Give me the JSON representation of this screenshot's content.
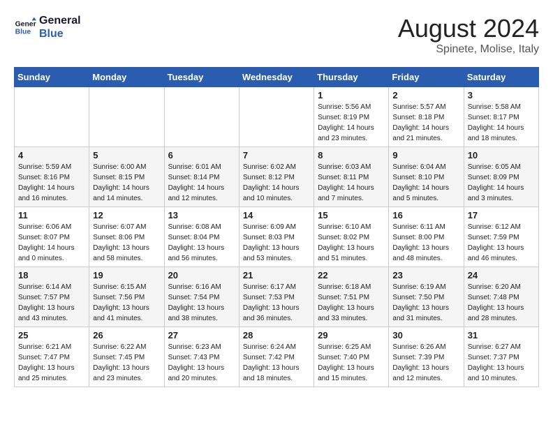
{
  "logo": {
    "line1": "General",
    "line2": "Blue"
  },
  "title": "August 2024",
  "location": "Spinete, Molise, Italy",
  "days_header": [
    "Sunday",
    "Monday",
    "Tuesday",
    "Wednesday",
    "Thursday",
    "Friday",
    "Saturday"
  ],
  "weeks": [
    [
      {
        "day": "",
        "info": ""
      },
      {
        "day": "",
        "info": ""
      },
      {
        "day": "",
        "info": ""
      },
      {
        "day": "",
        "info": ""
      },
      {
        "day": "1",
        "info": "Sunrise: 5:56 AM\nSunset: 8:19 PM\nDaylight: 14 hours\nand 23 minutes."
      },
      {
        "day": "2",
        "info": "Sunrise: 5:57 AM\nSunset: 8:18 PM\nDaylight: 14 hours\nand 21 minutes."
      },
      {
        "day": "3",
        "info": "Sunrise: 5:58 AM\nSunset: 8:17 PM\nDaylight: 14 hours\nand 18 minutes."
      }
    ],
    [
      {
        "day": "4",
        "info": "Sunrise: 5:59 AM\nSunset: 8:16 PM\nDaylight: 14 hours\nand 16 minutes."
      },
      {
        "day": "5",
        "info": "Sunrise: 6:00 AM\nSunset: 8:15 PM\nDaylight: 14 hours\nand 14 minutes."
      },
      {
        "day": "6",
        "info": "Sunrise: 6:01 AM\nSunset: 8:14 PM\nDaylight: 14 hours\nand 12 minutes."
      },
      {
        "day": "7",
        "info": "Sunrise: 6:02 AM\nSunset: 8:12 PM\nDaylight: 14 hours\nand 10 minutes."
      },
      {
        "day": "8",
        "info": "Sunrise: 6:03 AM\nSunset: 8:11 PM\nDaylight: 14 hours\nand 7 minutes."
      },
      {
        "day": "9",
        "info": "Sunrise: 6:04 AM\nSunset: 8:10 PM\nDaylight: 14 hours\nand 5 minutes."
      },
      {
        "day": "10",
        "info": "Sunrise: 6:05 AM\nSunset: 8:09 PM\nDaylight: 14 hours\nand 3 minutes."
      }
    ],
    [
      {
        "day": "11",
        "info": "Sunrise: 6:06 AM\nSunset: 8:07 PM\nDaylight: 14 hours\nand 0 minutes."
      },
      {
        "day": "12",
        "info": "Sunrise: 6:07 AM\nSunset: 8:06 PM\nDaylight: 13 hours\nand 58 minutes."
      },
      {
        "day": "13",
        "info": "Sunrise: 6:08 AM\nSunset: 8:04 PM\nDaylight: 13 hours\nand 56 minutes."
      },
      {
        "day": "14",
        "info": "Sunrise: 6:09 AM\nSunset: 8:03 PM\nDaylight: 13 hours\nand 53 minutes."
      },
      {
        "day": "15",
        "info": "Sunrise: 6:10 AM\nSunset: 8:02 PM\nDaylight: 13 hours\nand 51 minutes."
      },
      {
        "day": "16",
        "info": "Sunrise: 6:11 AM\nSunset: 8:00 PM\nDaylight: 13 hours\nand 48 minutes."
      },
      {
        "day": "17",
        "info": "Sunrise: 6:12 AM\nSunset: 7:59 PM\nDaylight: 13 hours\nand 46 minutes."
      }
    ],
    [
      {
        "day": "18",
        "info": "Sunrise: 6:14 AM\nSunset: 7:57 PM\nDaylight: 13 hours\nand 43 minutes."
      },
      {
        "day": "19",
        "info": "Sunrise: 6:15 AM\nSunset: 7:56 PM\nDaylight: 13 hours\nand 41 minutes."
      },
      {
        "day": "20",
        "info": "Sunrise: 6:16 AM\nSunset: 7:54 PM\nDaylight: 13 hours\nand 38 minutes."
      },
      {
        "day": "21",
        "info": "Sunrise: 6:17 AM\nSunset: 7:53 PM\nDaylight: 13 hours\nand 36 minutes."
      },
      {
        "day": "22",
        "info": "Sunrise: 6:18 AM\nSunset: 7:51 PM\nDaylight: 13 hours\nand 33 minutes."
      },
      {
        "day": "23",
        "info": "Sunrise: 6:19 AM\nSunset: 7:50 PM\nDaylight: 13 hours\nand 31 minutes."
      },
      {
        "day": "24",
        "info": "Sunrise: 6:20 AM\nSunset: 7:48 PM\nDaylight: 13 hours\nand 28 minutes."
      }
    ],
    [
      {
        "day": "25",
        "info": "Sunrise: 6:21 AM\nSunset: 7:47 PM\nDaylight: 13 hours\nand 25 minutes."
      },
      {
        "day": "26",
        "info": "Sunrise: 6:22 AM\nSunset: 7:45 PM\nDaylight: 13 hours\nand 23 minutes."
      },
      {
        "day": "27",
        "info": "Sunrise: 6:23 AM\nSunset: 7:43 PM\nDaylight: 13 hours\nand 20 minutes."
      },
      {
        "day": "28",
        "info": "Sunrise: 6:24 AM\nSunset: 7:42 PM\nDaylight: 13 hours\nand 18 minutes."
      },
      {
        "day": "29",
        "info": "Sunrise: 6:25 AM\nSunset: 7:40 PM\nDaylight: 13 hours\nand 15 minutes."
      },
      {
        "day": "30",
        "info": "Sunrise: 6:26 AM\nSunset: 7:39 PM\nDaylight: 13 hours\nand 12 minutes."
      },
      {
        "day": "31",
        "info": "Sunrise: 6:27 AM\nSunset: 7:37 PM\nDaylight: 13 hours\nand 10 minutes."
      }
    ]
  ]
}
